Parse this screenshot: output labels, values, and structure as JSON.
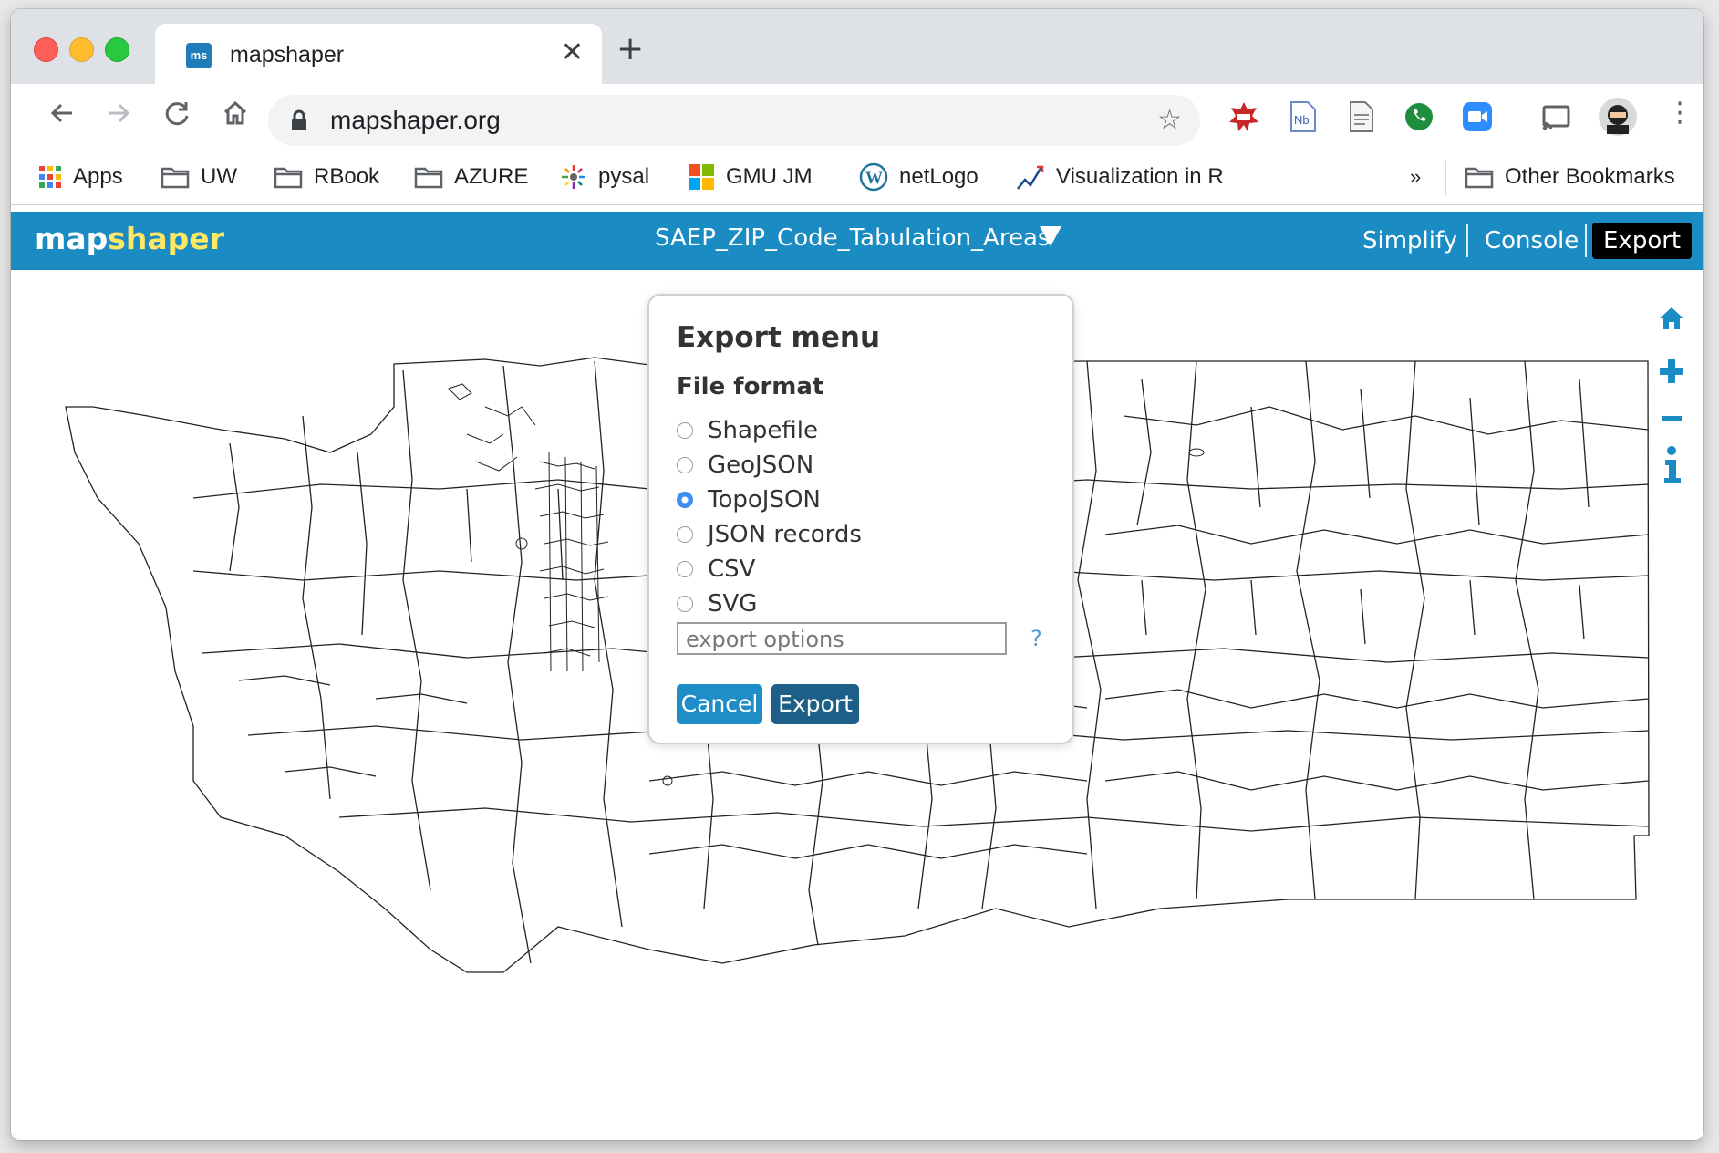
{
  "browser": {
    "tab_title": "mapshaper",
    "tab_favicon_text": "ms",
    "url": "mapshaper.org",
    "bookmarks": [
      {
        "label": "Apps",
        "icon": "apps-grid-icon"
      },
      {
        "label": "UW",
        "icon": "folder-icon"
      },
      {
        "label": "RBook",
        "icon": "folder-icon"
      },
      {
        "label": "AZURE",
        "icon": "folder-icon"
      },
      {
        "label": "pysal",
        "icon": "pysal-icon"
      },
      {
        "label": "GMU JM",
        "icon": "microsoft-icon"
      },
      {
        "label": "netLogo",
        "icon": "wordpress-icon"
      },
      {
        "label": "Visualization in R",
        "icon": "chart-line-icon"
      },
      {
        "label": "Other Bookmarks",
        "icon": "folder-icon"
      }
    ],
    "overflow_label": "»"
  },
  "app": {
    "logo_left": "map",
    "logo_right": "shaper",
    "layer_name": "SAEP_ZIP_Code_Tabulation_Areas",
    "header_buttons": {
      "simplify": "Simplify",
      "console": "Console",
      "export": "Export"
    },
    "colors": {
      "header": "#1a8cc3",
      "accent": "#ffe766"
    }
  },
  "export_dialog": {
    "title": "Export menu",
    "file_format_label": "File format",
    "formats": [
      {
        "label": "Shapefile",
        "selected": false
      },
      {
        "label": "GeoJSON",
        "selected": false
      },
      {
        "label": "TopoJSON",
        "selected": true
      },
      {
        "label": "JSON records",
        "selected": false
      },
      {
        "label": "CSV",
        "selected": false
      },
      {
        "label": "SVG",
        "selected": false
      }
    ],
    "options_placeholder": "export options",
    "help_label": "?",
    "cancel_label": "Cancel",
    "export_label": "Export"
  }
}
